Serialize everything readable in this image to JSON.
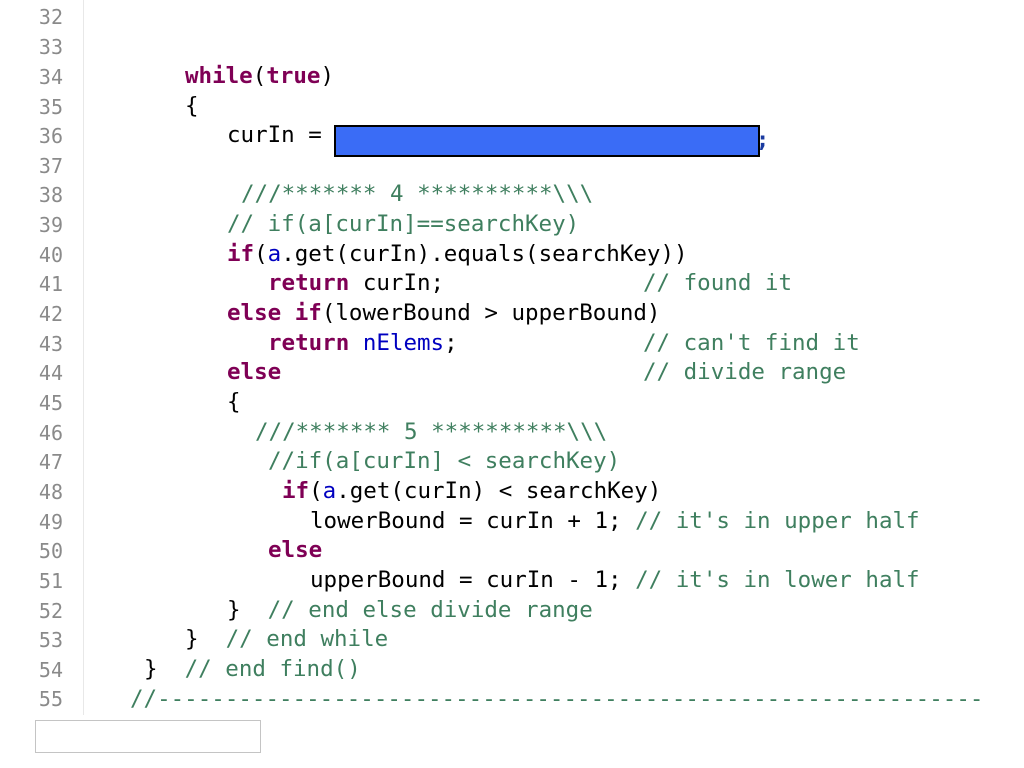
{
  "editor": {
    "line_numbers": [
      "32",
      "33",
      "34",
      "35",
      "36",
      "37",
      "38",
      "39",
      "40",
      "41",
      "42",
      "43",
      "44",
      "45",
      "46",
      "47",
      "48",
      "49",
      "50",
      "51",
      "52",
      "53",
      "54",
      "55"
    ],
    "lines": {
      "l34": {
        "kw1": "while",
        "rest": "(",
        "kw2": "true",
        "end": ")"
      },
      "l35": {
        "text": "{"
      },
      "l36": {
        "text": "curIn = ",
        "redacted": "redacted expression",
        "tail": ";"
      },
      "l38": {
        "comment": "///******* 4 **********\\\\\\"
      },
      "l39": {
        "comment": "// if(a[curIn]==searchKey)"
      },
      "l40": {
        "kw": "if",
        "p1": "(",
        "field": "a",
        "rest": ".get(curIn).equals(searchKey))"
      },
      "l41": {
        "kw": "return",
        "rest": " curIn;",
        "pad": "             ",
        "comment": "// found it"
      },
      "l42": {
        "kw1": "else",
        "sp": " ",
        "kw2": "if",
        "rest": "(lowerBound > upperBound)"
      },
      "l43": {
        "kw": "return",
        "sp": " ",
        "field": "nElems",
        "rest": ";",
        "pad": "            ",
        "comment": "// can't find it"
      },
      "l44": {
        "kw": "else",
        "pad": "                        ",
        "comment": "// divide range"
      },
      "l45": {
        "text": "{"
      },
      "l46": {
        "comment": "///******* 5 **********\\\\\\"
      },
      "l47": {
        "comment": "//if(a[curIn] < searchKey)"
      },
      "l48": {
        "kw": "if",
        "p1": "(",
        "field": "a",
        "rest": ".get(curIn) < searchKey)"
      },
      "l49": {
        "text": "lowerBound = curIn + 1; ",
        "comment": "// it's in upper half"
      },
      "l50": {
        "kw": "else"
      },
      "l51": {
        "text": "upperBound = curIn - 1; ",
        "comment": "// it's in lower half"
      },
      "l52": {
        "text": "}  ",
        "comment": "// end else divide range"
      },
      "l53": {
        "text": "}  ",
        "comment": "// end while"
      },
      "l54": {
        "text": "}  ",
        "comment": "// end find()"
      },
      "l55": {
        "comment": "//-------------------------------------------------------------"
      }
    }
  }
}
